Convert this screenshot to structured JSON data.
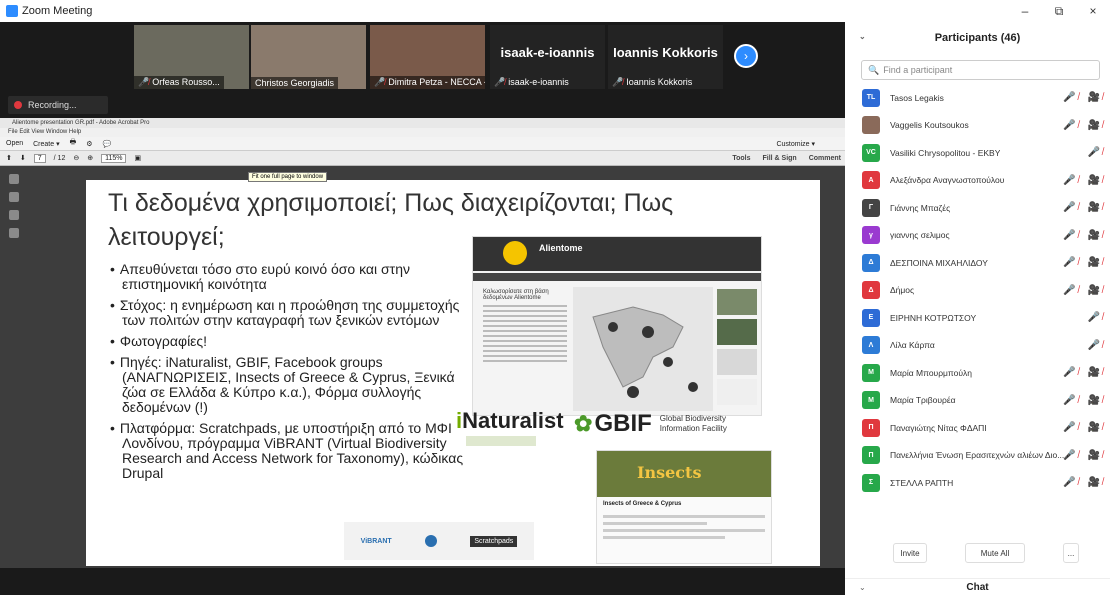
{
  "window": {
    "title": "Zoom Meeting",
    "minimize": "–",
    "maximize": "⧉",
    "close": "×"
  },
  "video_strip": {
    "tiles": [
      {
        "name": "Orfeas Rousso...",
        "type": "video",
        "bg": "#6b6a5e"
      },
      {
        "name": "Christos Georgiadis",
        "type": "video",
        "bg": "#8a7a6c"
      },
      {
        "name": "Dimitra Petza - NECCA - ...",
        "type": "video",
        "bg": "#7a5a4a"
      },
      {
        "name": "isaak-e-ioannis",
        "big": "isaak-e-ioannis",
        "type": "name"
      },
      {
        "name": "Ioannis Kokkoris",
        "big": "Ioannis Kokkoris",
        "type": "name"
      }
    ],
    "next_icon": "›",
    "recording_label": "Recording..."
  },
  "acrobat": {
    "title": "Alientome presentation GR.pdf - Adobe Acrobat Pro",
    "menu": "File   Edit   View   Window   Help",
    "open_label": "Open",
    "create_label": "Create ▾",
    "customize_label": "Customize ▾",
    "page_current": "7",
    "page_total": "/ 12",
    "zoom": "115%",
    "tooltip": "Fit one full page to window",
    "right_tools": [
      "Tools",
      "Fill & Sign",
      "Comment"
    ]
  },
  "slide": {
    "title": "Τι δεδομένα χρησιμοποιεί; Πως διαχειρίζονται; Πως λειτουργεί;",
    "bullets": [
      "Απευθύνεται τόσο στο ευρύ κοινό όσο και στην επιστημονική κοινότητα",
      "Στόχος: η ενημέρωση και η προώθηση της συμμετοχής των πολιτών στην καταγραφή των ξενικών εντόμων",
      "Φωτογραφίες!",
      "Πηγές: iNaturalist, GBIF, Facebook groups (ΑΝΑΓΝΩΡΙΣΕΙΣ, Insects of Greece & Cyprus, Ξενικά ζώα σε Ελλάδα & Κύπρο κ.α.), Φόρμα συλλογής δεδομένων (!)",
      "Πλατφόρμα: Scratchpads, με υποστήριξη από το ΜΦΙ Λονδίνου, πρόγραμμα ViBRANT (Virtual Biodiversity Research and Access Network for Taxonomy), κώδικας Drupal"
    ],
    "website_title": "Alientome",
    "website_caption": "Καλωσορίσατε στη βάση δεδομένων Alientome",
    "inat_i": "i",
    "inat_rest": "Naturalist",
    "gbif_word": "GBIF",
    "gbif_desc": "Global Biodiversity Information Facility",
    "fb_banner": "Insects",
    "fb_title": "Insects of Greece & Cyprus",
    "logo_vibrant": "ViBRANT",
    "logo_scratchpads": "Scratchpads"
  },
  "participants": {
    "header": "Participants (46)",
    "search_placeholder": "Find a participant",
    "list": [
      {
        "initials": "TL",
        "name": "Tasos Legakis",
        "color": "#2d6bd6",
        "icons": "🎤̸ 🎥̸"
      },
      {
        "initials": "",
        "name": "Vaggelis Koutsoukos",
        "color": "#8a6a5a",
        "icons": "🎤̸ 🎥̸"
      },
      {
        "initials": "VC",
        "name": "Vasiliki Chrysopolitou - EKBY",
        "color": "#27a84a",
        "icons": "🎤̸"
      },
      {
        "initials": "Α",
        "name": "Αλεξάνδρα Αναγνωστοπούλου",
        "color": "#e0383e",
        "icons": "🎤̸ 🎥̸"
      },
      {
        "initials": "Γ",
        "name": "Γιάννης Μπαζές",
        "color": "#444",
        "icons": "🎤̸ 🎥̸"
      },
      {
        "initials": "γ",
        "name": "γιαννης σελιμος",
        "color": "#9a3ad0",
        "icons": "🎤̸ 🎥̸"
      },
      {
        "initials": "Δ",
        "name": "ΔΕΣΠΟΙΝΑ ΜΙΧΑΗΛΙΔΟΥ",
        "color": "#2d7bd6",
        "icons": "🎤̸ 🎥̸"
      },
      {
        "initials": "Δ",
        "name": "Δήμος",
        "color": "#e0383e",
        "icons": "🎤̸ 🎥̸"
      },
      {
        "initials": "Ε",
        "name": "ΕΙΡΗΝΗ ΚΟΤΡΩΤΣΟΥ",
        "color": "#2d6bd6",
        "icons": "🎤̸"
      },
      {
        "initials": "Λ",
        "name": "Λίλα Κάρπα",
        "color": "#2d7bd6",
        "icons": "🎤̸"
      },
      {
        "initials": "Μ",
        "name": "Μαρία Μπουρμπούλη",
        "color": "#27a84a",
        "icons": "🎤̸ 🎥̸"
      },
      {
        "initials": "Μ",
        "name": "Μαρία Τριβουρέα",
        "color": "#27a84a",
        "icons": "🎤̸ 🎥̸"
      },
      {
        "initials": "Π",
        "name": "Παναγιώτης Νίτας ΦΔΑΠΙ",
        "color": "#e0383e",
        "icons": "🎤̸ 🎥̸"
      },
      {
        "initials": "Π",
        "name": "Πανελλήνια Ένωση Ερασιτεχνών αλιέων Διο...",
        "color": "#27a84a",
        "icons": "🎤̸ 🎥̸"
      },
      {
        "initials": "Σ",
        "name": "ΣΤΕΛΛΑ ΡΑΠΤΗ",
        "color": "#27a84a",
        "icons": "🎤̸ 🎥̸"
      }
    ],
    "invite_label": "Invite",
    "mute_all_label": "Mute All",
    "more_label": "...",
    "chat_label": "Chat"
  }
}
